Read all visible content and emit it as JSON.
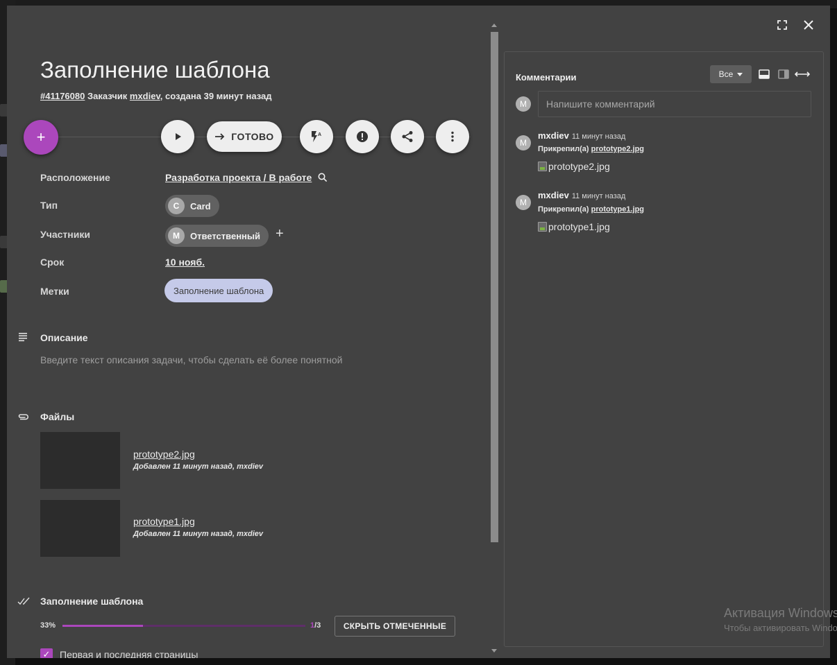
{
  "task": {
    "title": "Заполнение шаблона",
    "id": "#41176080",
    "customer_prefix": "Заказчик",
    "customer": "mxdiev",
    "created": ", создана 39 минут назад"
  },
  "actions": {
    "done_label": "ГОТОВО"
  },
  "fields": {
    "location_label": "Расположение",
    "location_value": "Разработка проекта / В работе",
    "type_label": "Тип",
    "type_avatar": "C",
    "type_value": "Card",
    "members_label": "Участники",
    "member_avatar": "M",
    "member_value": "Ответственный",
    "deadline_label": "Срок",
    "deadline_value": "10 нояб.",
    "tags_label": "Метки",
    "tag_value": "Заполнение шаблона"
  },
  "description": {
    "heading": "Описание",
    "placeholder": "Введите текст описания задачи, чтобы сделать её более понятной"
  },
  "files": {
    "heading": "Файлы",
    "items": [
      {
        "name": "prototype2.jpg",
        "meta": "Добавлен 11 минут назад, mxdiev"
      },
      {
        "name": "prototype1.jpg",
        "meta": "Добавлен 11 минут назад, mxdiev"
      }
    ]
  },
  "checklist": {
    "heading": "Заполнение шаблона",
    "percent_label": "33%",
    "progress": 0.33,
    "done": "1",
    "total": "/3",
    "hide_button": "СКРЫТЬ ОТМЕЧЕННЫЕ",
    "items": [
      {
        "label": "Первая и последняя страницы",
        "checked": true
      }
    ]
  },
  "comments": {
    "heading": "Комментарии",
    "filter": "Все",
    "user_avatar": "M",
    "input_placeholder": "Напишите комментарий",
    "items": [
      {
        "avatar": "M",
        "author": "mxdiev",
        "time": "11 минут назад",
        "action": "Прикрепил(а)",
        "file": "prototype2.jpg",
        "image_alt": "prototype2.jpg"
      },
      {
        "avatar": "M",
        "author": "mxdiev",
        "time": "11 минут назад",
        "action": "Прикрепил(а)",
        "file": "prototype1.jpg",
        "image_alt": "prototype1.jpg"
      }
    ]
  },
  "watermark": {
    "line1": "Активация Windows",
    "line2": "Чтобы активировать Windows"
  },
  "colors": {
    "accent": "#ab47bc",
    "tag_bg": "#c5cae9",
    "modal_bg": "#424242"
  }
}
